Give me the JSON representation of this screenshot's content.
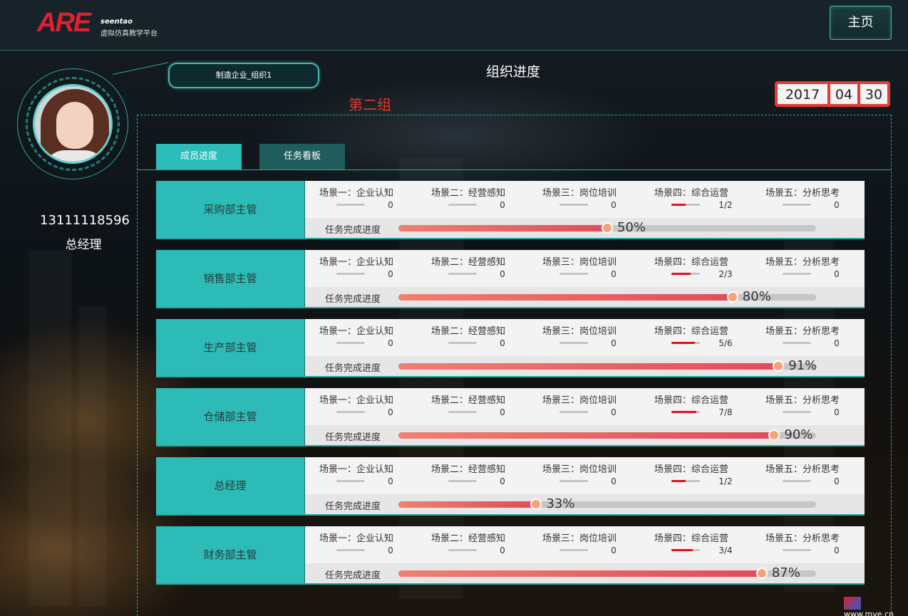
{
  "header": {
    "logo_text": "ARE",
    "logo_sub1": "seentao",
    "logo_sub2": "虚拟仿真教学平台",
    "home_label": "主页"
  },
  "profile": {
    "phone": "13111118596",
    "role": "总经理"
  },
  "company_tag": "制造企业_组织1",
  "page_title": "组织进度",
  "group_label": "第二组",
  "date": {
    "year": "2017",
    "month": "04",
    "day": "30"
  },
  "tabs": [
    {
      "label": "成员进度",
      "active": true
    },
    {
      "label": "任务看板",
      "active": false
    }
  ],
  "task_label": "任务完成进度",
  "rows": [
    {
      "name": "采购部主管",
      "scenes": [
        {
          "name": "场景一：企业认知",
          "value": "0",
          "fraction": 0
        },
        {
          "name": "场景二：经营感知",
          "value": "0",
          "fraction": 0
        },
        {
          "name": "场景三：岗位培训",
          "value": "0",
          "fraction": 0
        },
        {
          "name": "场景四：综合运营",
          "value": "1/2",
          "fraction": 0.5
        },
        {
          "name": "场景五：分析思考",
          "value": "0",
          "fraction": 0
        }
      ],
      "progress": 50,
      "progress_text": "50%"
    },
    {
      "name": "销售部主管",
      "scenes": [
        {
          "name": "场景一：企业认知",
          "value": "0",
          "fraction": 0
        },
        {
          "name": "场景二：经营感知",
          "value": "0",
          "fraction": 0
        },
        {
          "name": "场景三：岗位培训",
          "value": "0",
          "fraction": 0
        },
        {
          "name": "场景四：综合运营",
          "value": "2/3",
          "fraction": 0.667
        },
        {
          "name": "场景五：分析思考",
          "value": "0",
          "fraction": 0
        }
      ],
      "progress": 80,
      "progress_text": "80%"
    },
    {
      "name": "生产部主管",
      "scenes": [
        {
          "name": "场景一：企业认知",
          "value": "0",
          "fraction": 0
        },
        {
          "name": "场景二：经营感知",
          "value": "0",
          "fraction": 0
        },
        {
          "name": "场景三：岗位培训",
          "value": "0",
          "fraction": 0
        },
        {
          "name": "场景四：综合运营",
          "value": "5/6",
          "fraction": 0.833
        },
        {
          "name": "场景五：分析思考",
          "value": "0",
          "fraction": 0
        }
      ],
      "progress": 91,
      "progress_text": "91%"
    },
    {
      "name": "仓储部主管",
      "scenes": [
        {
          "name": "场景一：企业认知",
          "value": "0",
          "fraction": 0
        },
        {
          "name": "场景二：经营感知",
          "value": "0",
          "fraction": 0
        },
        {
          "name": "场景三：岗位培训",
          "value": "0",
          "fraction": 0
        },
        {
          "name": "场景四：综合运营",
          "value": "7/8",
          "fraction": 0.875
        },
        {
          "name": "场景五：分析思考",
          "value": "0",
          "fraction": 0
        }
      ],
      "progress": 90,
      "progress_text": "90%"
    },
    {
      "name": "总经理",
      "scenes": [
        {
          "name": "场景一：企业认知",
          "value": "0",
          "fraction": 0
        },
        {
          "name": "场景二：经营感知",
          "value": "0",
          "fraction": 0
        },
        {
          "name": "场景三：岗位培训",
          "value": "0",
          "fraction": 0
        },
        {
          "name": "场景四：综合运营",
          "value": "1/2",
          "fraction": 0.5
        },
        {
          "name": "场景五：分析思考",
          "value": "0",
          "fraction": 0
        }
      ],
      "progress": 33,
      "progress_text": "33%"
    },
    {
      "name": "财务部主管",
      "scenes": [
        {
          "name": "场景一：企业认知",
          "value": "0",
          "fraction": 0
        },
        {
          "name": "场景二：经营感知",
          "value": "0",
          "fraction": 0
        },
        {
          "name": "场景三：岗位培训",
          "value": "0",
          "fraction": 0
        },
        {
          "name": "场景四：综合运营",
          "value": "3/4",
          "fraction": 0.75
        },
        {
          "name": "场景五：分析思考",
          "value": "0",
          "fraction": 0
        }
      ],
      "progress": 87,
      "progress_text": "87%"
    }
  ],
  "watermark": "www.mve.cn",
  "colors": {
    "teal": "#2cbbb6",
    "accent_red": "#e43b34",
    "bar_red": "#e4101a"
  }
}
